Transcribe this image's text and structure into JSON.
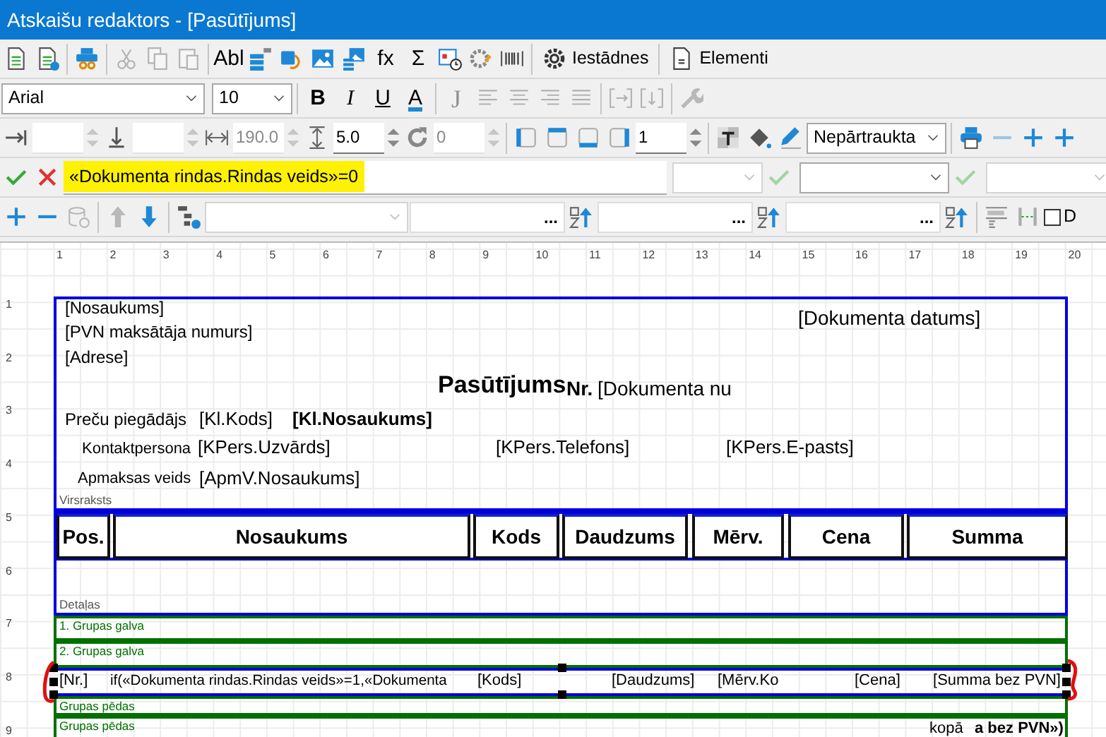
{
  "window": {
    "title": "Atskaišu redaktors - [Pasūtījums]"
  },
  "main_toolbar": [
    {
      "kind": "save",
      "disabled": false
    },
    {
      "kind": "save-help",
      "disabled": false
    },
    {
      "kind": "separator"
    },
    {
      "kind": "print-preview",
      "disabled": false
    },
    {
      "kind": "separator"
    },
    {
      "kind": "cut",
      "disabled": true
    },
    {
      "kind": "copy",
      "disabled": true
    },
    {
      "kind": "paste",
      "disabled": true
    },
    {
      "kind": "separator"
    },
    {
      "kind": "glyph",
      "label": "Abl",
      "disabled": false
    },
    {
      "kind": "data-field",
      "disabled": false
    },
    {
      "kind": "shape",
      "disabled": false
    },
    {
      "kind": "picture",
      "disabled": false
    },
    {
      "kind": "data-picture",
      "disabled": false
    },
    {
      "kind": "glyph",
      "label": "fx",
      "disabled": false
    },
    {
      "kind": "glyph",
      "label": "Σ",
      "disabled": false
    },
    {
      "kind": "calendar-clock",
      "disabled": false
    },
    {
      "kind": "gear-pin",
      "disabled": false
    },
    {
      "kind": "barcode",
      "disabled": false
    },
    {
      "kind": "separator"
    },
    {
      "kind": "settings-button",
      "label": "Iestādnes",
      "disabled": false
    },
    {
      "kind": "separator"
    },
    {
      "kind": "elements-button",
      "label": "Elementi",
      "disabled": false
    }
  ],
  "format_toolbar": {
    "font": "Arial",
    "size": "10",
    "tools": [
      {
        "kind": "glyph",
        "label": "B",
        "disabled": false
      },
      {
        "kind": "glyph",
        "label": "I",
        "disabled": false
      },
      {
        "kind": "glyph",
        "label": "U",
        "disabled": false
      },
      {
        "kind": "glyph",
        "label": "A",
        "disabled": false
      },
      {
        "kind": "separator"
      },
      {
        "kind": "glyph",
        "label": "J",
        "disabled": true
      },
      {
        "kind": "align-left",
        "disabled": true
      },
      {
        "kind": "align-center",
        "disabled": true
      },
      {
        "kind": "align-right",
        "disabled": true
      },
      {
        "kind": "justify",
        "disabled": true
      },
      {
        "kind": "separator"
      },
      {
        "kind": "bracket-right",
        "disabled": true
      },
      {
        "kind": "bracket-down",
        "disabled": true
      },
      {
        "kind": "separator"
      },
      {
        "kind": "wrench",
        "disabled": true
      }
    ]
  },
  "position_toolbar": [
    {
      "kind": "arrow-right",
      "disabled": false
    },
    {
      "kind": "spin",
      "disabled": true
    },
    {
      "kind": "arrow-down",
      "disabled": false
    },
    {
      "kind": "spin",
      "disabled": true
    },
    {
      "kind": "width",
      "disabled": false
    },
    {
      "kind": "spin",
      "value": "190.0",
      "disabled": true
    },
    {
      "kind": "height",
      "disabled": false
    },
    {
      "kind": "spin",
      "value": "5.0",
      "disabled": false
    },
    {
      "kind": "rotate",
      "disabled": false
    },
    {
      "kind": "spin",
      "value": "0",
      "disabled": true
    },
    {
      "kind": "separator"
    },
    {
      "kind": "border-left",
      "disabled": false
    },
    {
      "kind": "border-top",
      "disabled": false
    },
    {
      "kind": "border-bottom",
      "disabled": false
    },
    {
      "kind": "border-right",
      "disabled": false
    },
    {
      "kind": "spin",
      "value": "1",
      "disabled": false
    },
    {
      "kind": "separator"
    },
    {
      "kind": "text-bg",
      "disabled": false
    },
    {
      "kind": "fill",
      "disabled": false
    },
    {
      "kind": "pencil",
      "disabled": false
    },
    {
      "kind": "dropdown",
      "value": "Nepārtraukta",
      "disabled": false
    },
    {
      "kind": "separator"
    },
    {
      "kind": "printer",
      "disabled": false
    },
    {
      "kind": "minus",
      "disabled": true
    },
    {
      "kind": "plus",
      "disabled": false
    },
    {
      "kind": "plus",
      "disabled": false
    }
  ],
  "formula_bar": {
    "value": "«Dokumenta rindas.Rindas veids»=0",
    "highlighted": true,
    "controls": [
      {
        "kind": "dropdown",
        "disabled": true
      },
      {
        "kind": "check"
      },
      {
        "kind": "dropdown",
        "disabled": false
      },
      {
        "kind": "check"
      },
      {
        "kind": "dropdown",
        "disabled": true
      }
    ]
  },
  "group_toolbar": [
    {
      "kind": "plus",
      "disabled": false
    },
    {
      "kind": "minus",
      "disabled": false
    },
    {
      "kind": "db-add",
      "disabled": true
    },
    {
      "kind": "separator"
    },
    {
      "kind": "up",
      "disabled": true
    },
    {
      "kind": "down",
      "disabled": false
    },
    {
      "kind": "separator"
    },
    {
      "kind": "tree-add",
      "disabled": false
    },
    {
      "kind": "dropdown",
      "disabled": true
    },
    {
      "kind": "browse",
      "button": "..."
    },
    {
      "kind": "sort",
      "disabled": false
    },
    {
      "kind": "browse",
      "button": "..."
    },
    {
      "kind": "sort",
      "disabled": false
    },
    {
      "kind": "browse",
      "button": "..."
    },
    {
      "kind": "sort",
      "disabled": false
    },
    {
      "kind": "separator"
    },
    {
      "kind": "sum-format",
      "disabled": false
    },
    {
      "kind": "line-gap",
      "disabled": false
    },
    {
      "kind": "checkbox",
      "checked": false,
      "label": "D"
    }
  ],
  "ruler": {
    "columns": [
      "1",
      "2",
      "3",
      "4",
      "5",
      "6",
      "7",
      "8",
      "9",
      "10",
      "11",
      "12",
      "13",
      "14",
      "15",
      "16",
      "17",
      "18",
      "19",
      "20"
    ],
    "rows": [
      "1",
      "2",
      "3",
      "4",
      "5",
      "6",
      "7",
      "8",
      "9"
    ]
  },
  "report": {
    "bands": [
      {
        "label": "Virsraksts",
        "kind": "section"
      },
      {
        "label": "Detaļas",
        "kind": "section"
      },
      {
        "label": "1. Grupas galva",
        "kind": "group"
      },
      {
        "label": "2. Grupas galva",
        "kind": "group"
      },
      {
        "label": "Grupas pēdas",
        "kind": "group"
      },
      {
        "label": "Grupas pēdas",
        "kind": "group"
      }
    ],
    "texts": [
      {
        "text": "[Nosaukums]",
        "bold": false
      },
      {
        "text": "[PVN maksātāja numurs]",
        "bold": false
      },
      {
        "text": "[Adrese]",
        "bold": false
      },
      {
        "text": "[Dokumenta datums]",
        "bold": false
      },
      {
        "text": "Pasūtījums",
        "bold": true
      },
      {
        "text": "Nr.",
        "bold": true
      },
      {
        "text": "[Dokumenta nu",
        "bold": false
      },
      {
        "text": "Preču piegādājs",
        "bold": false
      },
      {
        "text": "[Kl.Kods]",
        "bold": false
      },
      {
        "text": "[Kl.Nosaukums]",
        "bold": true
      },
      {
        "text": "Kontaktpersona",
        "bold": false
      },
      {
        "text": "[KPers.Uzvārds]",
        "bold": false
      },
      {
        "text": "[KPers.Telefons]",
        "bold": false
      },
      {
        "text": "[KPers.E-pasts]",
        "bold": false
      },
      {
        "text": "Apmaksas veids",
        "bold": false
      },
      {
        "text": "[ApmV.Nosaukums]",
        "bold": false
      }
    ],
    "column_headers": [
      "Pos.",
      "Nosaukums",
      "Kods",
      "Daudzums",
      "Mērv.",
      "Cena",
      "Summa"
    ],
    "detail_row": {
      "selected": true,
      "cells": [
        "[Nr.]",
        "if(«Dokumenta rindas.Rindas veids»=1,«Dokumenta",
        "[Kods]",
        "[Daudzums]",
        "[Mērv.Ko",
        "[Cena]",
        "[Summa bez PVN]"
      ]
    },
    "footer_texts": [
      {
        "text": "kopā",
        "bold": false
      },
      {
        "text": "a bez PVN»)",
        "bold": true
      }
    ]
  }
}
